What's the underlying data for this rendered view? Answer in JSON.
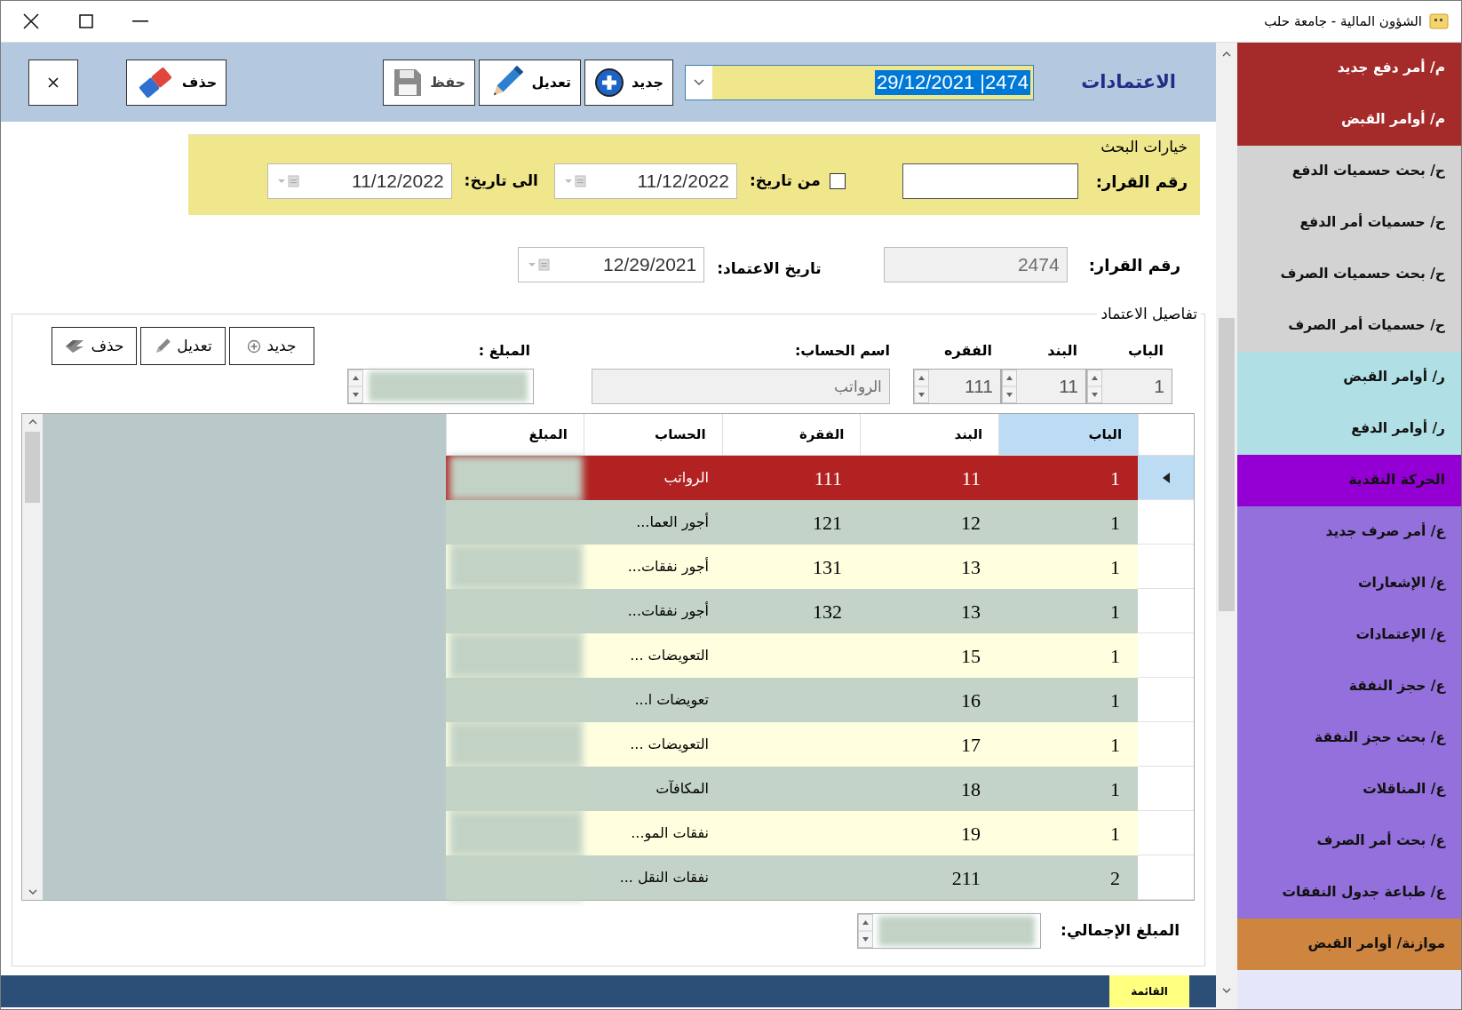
{
  "window": {
    "title": "الشؤون المالية - جامعة حلب"
  },
  "header": {
    "title": "الاعتمادات",
    "record_selector": {
      "value": "2474| 29/12/2021"
    },
    "buttons": [
      {
        "label": "جديد",
        "kind": "new",
        "disabled": false
      },
      {
        "label": "تعديل",
        "kind": "edit",
        "disabled": false
      },
      {
        "label": "حفظ",
        "kind": "save",
        "disabled": true
      },
      {
        "label": "حذف",
        "kind": "delete",
        "disabled": false
      }
    ]
  },
  "search_options": {
    "title": "خيارات البحث",
    "decision_label": "رقم القرار:",
    "date_filter_checked": false,
    "from_label": "من تاريخ:",
    "from_date": "11/12/2022",
    "to_label": "الى تاريخ:",
    "to_date": "11/12/2022"
  },
  "record": {
    "decision_label": "رقم القرار:",
    "decision_number": "2474",
    "date_label": "تاريخ الاعتماد:",
    "date": "12/29/2021"
  },
  "details": {
    "title": "تفاصيل الاعتماد",
    "buttons": [
      {
        "label": "جديد",
        "kind": "new"
      },
      {
        "label": "تعديل",
        "kind": "edit"
      },
      {
        "label": "حذف",
        "kind": "delete"
      }
    ],
    "fields": [
      {
        "label": "الباب",
        "value": "1",
        "kind": "spinner"
      },
      {
        "label": "البند",
        "value": "11",
        "kind": "spinner"
      },
      {
        "label": "الفقره",
        "value": "111",
        "kind": "spinner"
      },
      {
        "label": "اسم الحساب:",
        "value": "الرواتب",
        "kind": "text"
      },
      {
        "label": "المبلغ :",
        "kind": "blurred_spinner"
      }
    ]
  },
  "table": {
    "columns": [
      {
        "label": "الباب",
        "selected": true
      },
      {
        "label": "البند",
        "selected": false
      },
      {
        "label": "الفقرة",
        "selected": false
      },
      {
        "label": "الحساب",
        "selected": false
      },
      {
        "label": "المبلغ",
        "selected": false
      }
    ],
    "rows": [
      {
        "bab": "1",
        "band": "11",
        "fiqra": "111",
        "account": "الرواتب",
        "selected": true
      },
      {
        "bab": "1",
        "band": "12",
        "fiqra": "121",
        "account": "أجور العما...",
        "selected": false
      },
      {
        "bab": "1",
        "band": "13",
        "fiqra": "131",
        "account": "أجور نفقات...",
        "selected": false
      },
      {
        "bab": "1",
        "band": "13",
        "fiqra": "132",
        "account": "أجور نفقات...",
        "selected": false
      },
      {
        "bab": "1",
        "band": "15",
        "account": "التعويضات ...",
        "selected": false
      },
      {
        "bab": "1",
        "band": "16",
        "account": "تعويضات ا...",
        "selected": false
      },
      {
        "bab": "1",
        "band": "17",
        "account": "التعويضات ...",
        "selected": false
      },
      {
        "bab": "1",
        "band": "18",
        "account": "المكافآت",
        "selected": false
      },
      {
        "bab": "1",
        "band": "19",
        "account": "نفقات المو...",
        "selected": false
      },
      {
        "bab": "2",
        "band": "211",
        "account": "نفقات النقل ...",
        "selected": false
      }
    ]
  },
  "total": {
    "label": "المبلغ الإجمالي:"
  },
  "sidebar": {
    "items": [
      {
        "label": "م/ أمر دفع جديد",
        "color": "#a52a2a"
      },
      {
        "label": "م/ أوامر القبض",
        "color": "#a52a2a"
      },
      {
        "label": "ح/ بحث حسميات الدفع",
        "color": "#d3d3d3"
      },
      {
        "label": "ح/ حسميات أمر الدفع",
        "color": "#d3d3d3"
      },
      {
        "label": "ح/ بحث حسميات الصرف",
        "color": "#d3d3d3"
      },
      {
        "label": "ح/ حسميات أمر الصرف",
        "color": "#d3d3d3"
      },
      {
        "label": "ر/ أوامر القبض",
        "color": "#b0e0e6"
      },
      {
        "label": "ر/ أوامر الدفع",
        "color": "#b0e0e6"
      },
      {
        "label": "الحركة النقدية",
        "color": "#9400d3"
      },
      {
        "label": "ع/ أمر صرف جديد",
        "color": "#9370db"
      },
      {
        "label": "ع/ الإشعارات",
        "color": "#9370db"
      },
      {
        "label": "ع/ الإعتمادات",
        "color": "#9370db"
      },
      {
        "label": "ع/ حجز النفقة",
        "color": "#9370db"
      },
      {
        "label": "ع/ بحث حجز النفقة",
        "color": "#9370db"
      },
      {
        "label": "ع/ المناقلات",
        "color": "#9370db"
      },
      {
        "label": "ع/ بحث أمر الصرف",
        "color": "#9370db"
      },
      {
        "label": "ع/ طباعة جدول النفقات",
        "color": "#9370db"
      },
      {
        "label": "موازنة/ أوامر القبض",
        "color": "#cd853f"
      }
    ]
  },
  "bottom_bar": {
    "tabs": [
      {
        "label": "القائمة",
        "selected": true
      }
    ]
  }
}
